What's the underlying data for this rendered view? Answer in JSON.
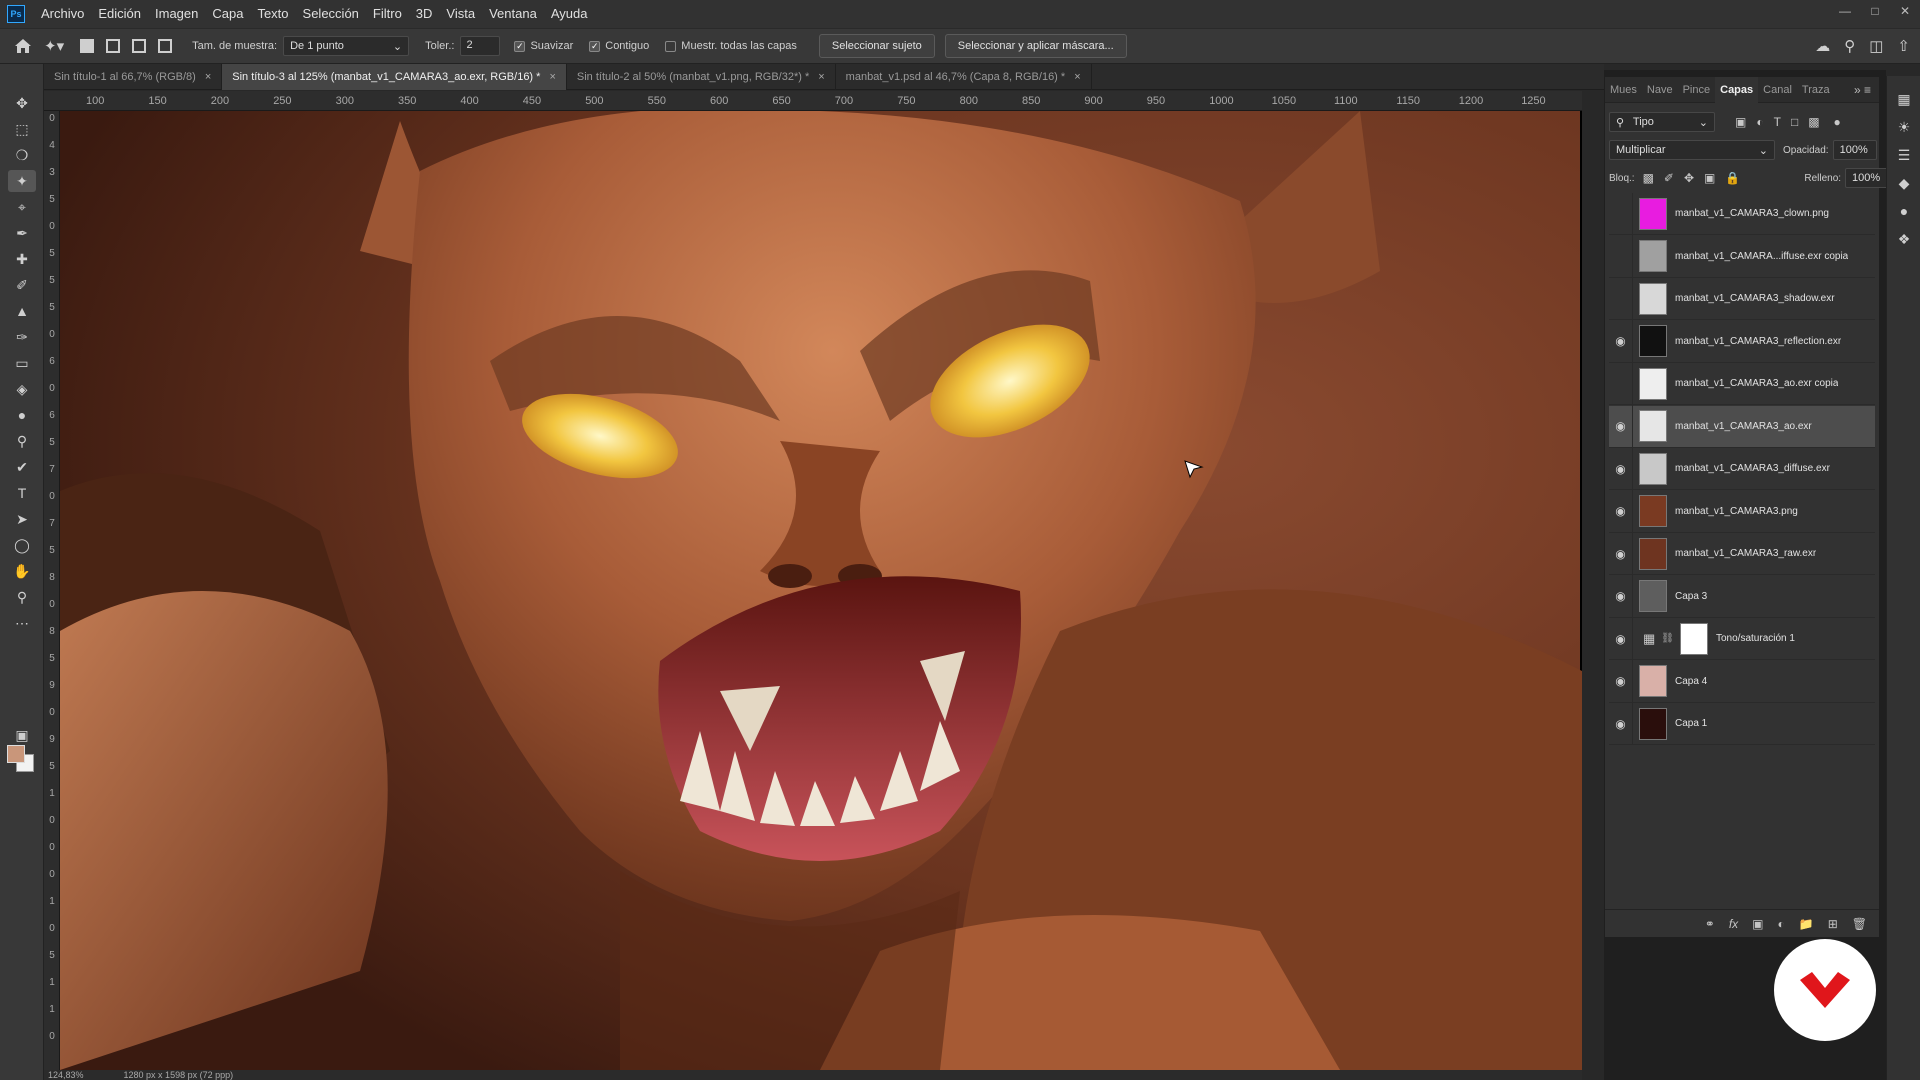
{
  "menu": {
    "app_logo": "Ps",
    "items": [
      "Archivo",
      "Edición",
      "Imagen",
      "Capa",
      "Texto",
      "Selección",
      "Filtro",
      "3D",
      "Vista",
      "Ventana",
      "Ayuda"
    ]
  },
  "window_controls": {
    "minimize_icon": "minimize-icon",
    "maximize_icon": "maximize-icon",
    "close_icon": "close-icon"
  },
  "options": {
    "sample_label": "Tam. de muestra:",
    "sample_value": "De 1 punto",
    "tolerance_label": "Toler.:",
    "tolerance_value": "2",
    "antialias_label": "Suavizar",
    "antialias_checked": true,
    "contiguous_label": "Contiguo",
    "contiguous_checked": true,
    "all_layers_label": "Muestr. todas las capas",
    "all_layers_checked": false,
    "select_subject_label": "Seleccionar sujeto",
    "select_mask_label": "Seleccionar y aplicar máscara..."
  },
  "tabs": [
    {
      "label": "Sin título-1 al 66,7% (RGB/8)",
      "active": false
    },
    {
      "label": "Sin título-3 al 125% (manbat_v1_CAMARA3_ao.exr, RGB/16) *",
      "active": true
    },
    {
      "label": "Sin título-2 al 50% (manbat_v1.png, RGB/32*) *",
      "active": false
    },
    {
      "label": "manbat_v1.psd al 46,7% (Capa 8, RGB/16) *",
      "active": false
    }
  ],
  "ruler_h": [
    "100",
    "150",
    "200",
    "250",
    "300",
    "350",
    "400",
    "450",
    "500",
    "550",
    "600",
    "650",
    "700",
    "750",
    "800",
    "850",
    "900",
    "950",
    "1000",
    "1050",
    "1100",
    "1150",
    "1200",
    "1250"
  ],
  "ruler_v": [
    "0",
    "4",
    "3",
    "5",
    "0",
    "5",
    "5",
    "5",
    "0",
    "6",
    "0",
    "6",
    "5",
    "7",
    "0",
    "7",
    "5",
    "8",
    "0",
    "8",
    "5",
    "9",
    "0",
    "9",
    "5",
    "1",
    "0",
    "0",
    "0",
    "1",
    "0",
    "5",
    "1",
    "1",
    "0"
  ],
  "status": {
    "zoom": "124,83%",
    "doc_size": "1280 px x 1598 px (72 ppp)"
  },
  "panel": {
    "tabs": [
      {
        "label": "Mues",
        "active": false
      },
      {
        "label": "Nave",
        "active": false
      },
      {
        "label": "Pince",
        "active": false
      },
      {
        "label": "Capas",
        "active": true
      },
      {
        "label": "Canal",
        "active": false
      },
      {
        "label": "Traza",
        "active": false
      }
    ],
    "filter_label": "Tipo",
    "blend_mode": "Multiplicar",
    "opacity_label": "Opacidad:",
    "opacity_value": "100%",
    "lock_label": "Bloq.:",
    "fill_label": "Relleno:",
    "fill_value": "100%"
  },
  "layers": [
    {
      "name": "manbat_v1_CAMARA3_clown.png",
      "visible": false,
      "selected": false,
      "thumb": "#e81ce0"
    },
    {
      "name": "manbat_v1_CAMARA...iffuse.exr copia",
      "visible": false,
      "selected": false,
      "thumb": "#a0a0a0"
    },
    {
      "name": "manbat_v1_CAMARA3_shadow.exr",
      "visible": false,
      "selected": false,
      "thumb": "#d8d8d8"
    },
    {
      "name": "manbat_v1_CAMARA3_reflection.exr",
      "visible": true,
      "selected": false,
      "thumb": "#111111"
    },
    {
      "name": "manbat_v1_CAMARA3_ao.exr copia",
      "visible": false,
      "selected": false,
      "thumb": "#eeeeee"
    },
    {
      "name": "manbat_v1_CAMARA3_ao.exr",
      "visible": true,
      "selected": true,
      "thumb": "#e6e6e6"
    },
    {
      "name": "manbat_v1_CAMARA3_diffuse.exr",
      "visible": true,
      "selected": false,
      "thumb": "#c8c8c8"
    },
    {
      "name": "manbat_v1_CAMARA3.png",
      "visible": true,
      "selected": false,
      "thumb": "#7a3a22"
    },
    {
      "name": "manbat_v1_CAMARA3_raw.exr",
      "visible": true,
      "selected": false,
      "thumb": "#6e3420"
    },
    {
      "name": "Capa 3",
      "visible": true,
      "selected": false,
      "thumb": "#5e5e5e"
    },
    {
      "name": "Tono/saturación 1",
      "visible": true,
      "selected": false,
      "thumb": "#ffffff",
      "adjustment": true
    },
    {
      "name": "Capa 4",
      "visible": true,
      "selected": false,
      "thumb": "#d9b0a8"
    },
    {
      "name": "Capa 1",
      "visible": true,
      "selected": false,
      "thumb": "#2a0e0c"
    }
  ],
  "colors": {
    "foreground": "#c9967a",
    "background": "#f2f2f2",
    "accent": "#31a8ff",
    "badge_red": "#e0161b"
  }
}
